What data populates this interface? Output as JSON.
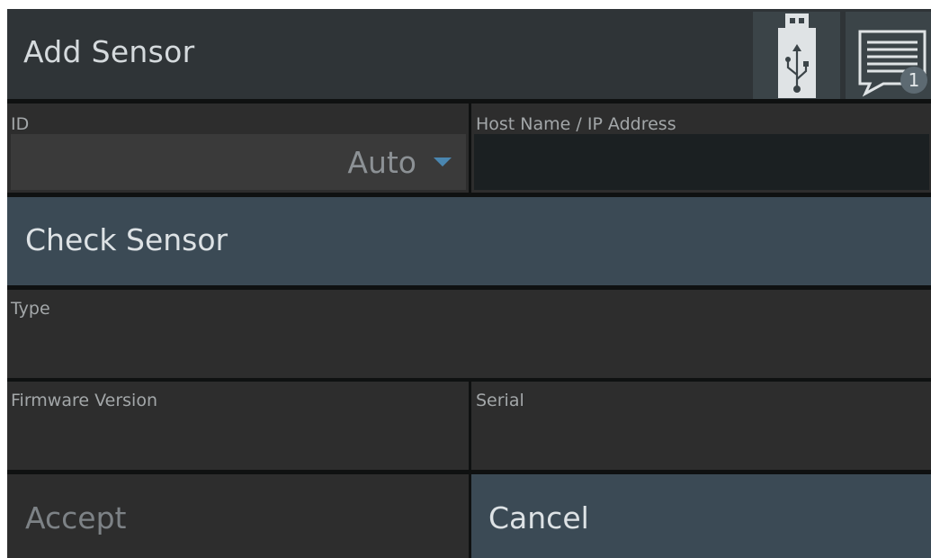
{
  "header": {
    "title": "Add Sensor",
    "usb_icon": "usb-icon",
    "messages_icon": "message-icon",
    "messages_count": "1"
  },
  "form": {
    "id": {
      "label": "ID",
      "value": "Auto"
    },
    "host": {
      "label": "Host Name / IP Address",
      "value": ""
    },
    "check_button": "Check Sensor",
    "type": {
      "label": "Type",
      "value": ""
    },
    "firmware": {
      "label": "Firmware Version",
      "value": ""
    },
    "serial": {
      "label": "Serial",
      "value": ""
    }
  },
  "actions": {
    "accept": "Accept",
    "cancel": "Cancel"
  },
  "colors": {
    "accent": "#4a86b0",
    "button": "#3b4a55",
    "panel": "#2d2d2d"
  }
}
